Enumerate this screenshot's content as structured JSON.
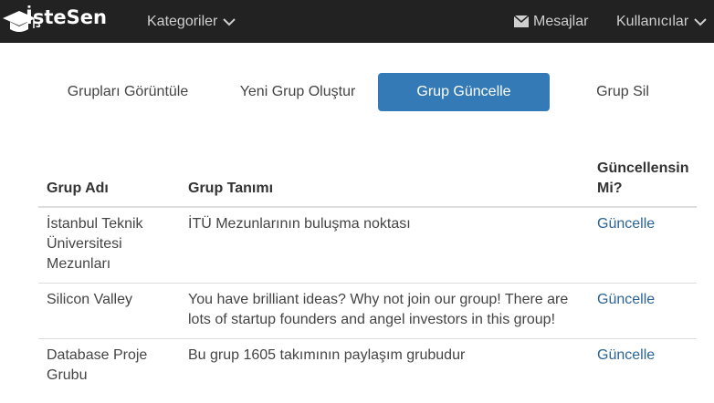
{
  "navbar": {
    "brand": "İşteSen",
    "kategoriler": "Kategoriler",
    "mesajlar": "Mesajlar",
    "kullanicilar": "Kullanıcılar",
    "icons": [
      "graduation-cap-icon",
      "chevron-down-icon",
      "envelope-icon"
    ]
  },
  "tabs": [
    {
      "label": "Grupları Görüntüle",
      "active": false
    },
    {
      "label": "Yeni Grup Oluştur",
      "active": false
    },
    {
      "label": "Grup Güncelle",
      "active": true
    },
    {
      "label": "Grup Sil",
      "active": false
    }
  ],
  "table": {
    "headers": [
      "Grup Adı",
      "Grup Tanımı",
      "Güncellensin Mi?"
    ],
    "rows": [
      {
        "name": "İstanbul Teknik Üniversitesi Mezunları",
        "description": "İTÜ Mezunlarının buluşma noktası",
        "action": "Güncelle"
      },
      {
        "name": "Silicon Valley",
        "description": "You have brilliant ideas? Why not join our group! There are lots of startup founders and angel investors in this group!",
        "action": "Güncelle"
      },
      {
        "name": "Database Proje Grubu",
        "description": "Bu grup 1605 takımının paylaşım grubudur",
        "action": "Güncelle"
      }
    ]
  },
  "colors": {
    "navbar": "#222222",
    "active_tab": "#337ab7",
    "link": "#2a6496"
  }
}
